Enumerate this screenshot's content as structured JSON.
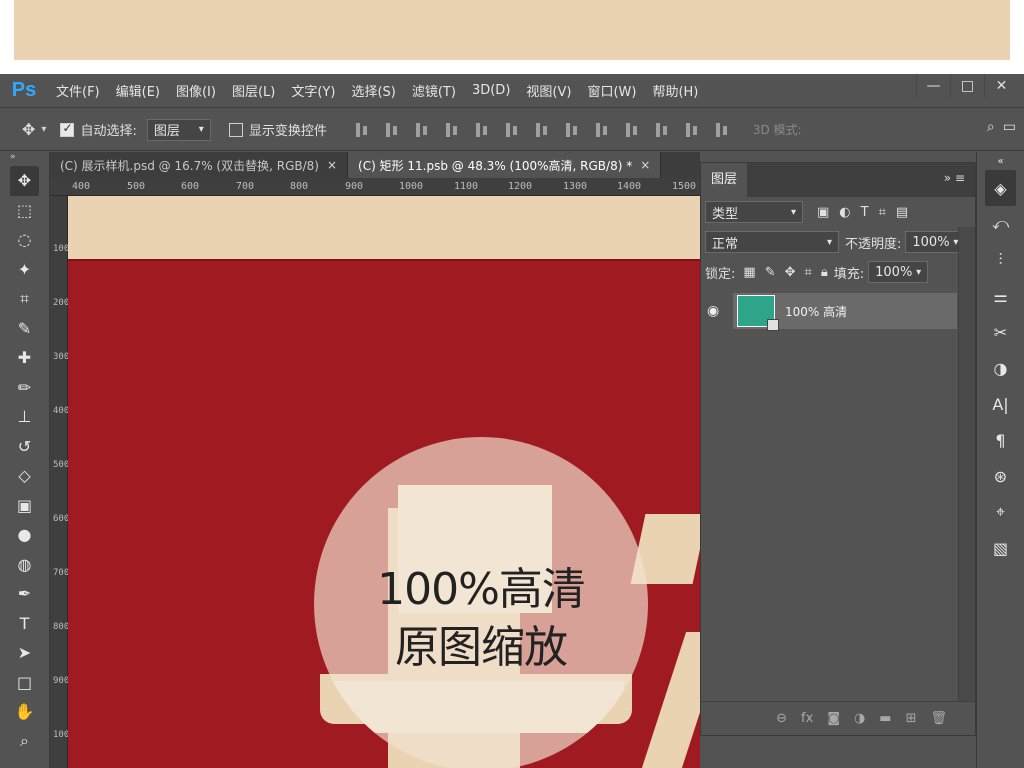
{
  "app": {
    "logo": "Ps",
    "menu": [
      "文件(F)",
      "编辑(E)",
      "图像(I)",
      "图层(L)",
      "文字(Y)",
      "选择(S)",
      "滤镜(T)",
      "3D(D)",
      "视图(V)",
      "窗口(W)",
      "帮助(H)"
    ],
    "window_controls": [
      "—",
      "□",
      "✕"
    ]
  },
  "options": {
    "move_icon": "move-tool-icon",
    "auto_select_label": "自动选择:",
    "auto_select_checked": true,
    "auto_select_target": "图层",
    "show_transform_label": "显示变换控件",
    "show_transform_checked": false,
    "mode_3d_label": "3D 模式:"
  },
  "tabs": [
    {
      "label": "(C) 展示样机.psd @ 16.7% (双击替换, RGB/8)",
      "close": "×",
      "active": false
    },
    {
      "label": "(C) 矩形 11.psb @ 48.3% (100%高清, RGB/8) *",
      "close": "×",
      "active": true
    }
  ],
  "ruler": {
    "top": [
      "400",
      "500",
      "600",
      "700",
      "800",
      "900",
      "1000",
      "1100",
      "1200",
      "1300",
      "1400",
      "1500"
    ],
    "left": [
      "100",
      "200",
      "300",
      "400",
      "500",
      "600",
      "700",
      "800",
      "900",
      "100"
    ]
  },
  "canvas": {
    "overlay_line1": "100%高清",
    "overlay_line2": "原图缩放",
    "colors": {
      "background": "#a01a21",
      "shape": "#e9d3b3",
      "circle": "#f2e2d2"
    }
  },
  "layers_panel": {
    "title": "图层",
    "filter_kind": "类型",
    "blend_mode": "正常",
    "opacity_label": "不透明度:",
    "opacity_value": "100%",
    "lock_label": "锁定:",
    "fill_label": "填充:",
    "fill_value": "100%",
    "layers": [
      {
        "name": "100% 高清",
        "visible": true,
        "thumb_color": "#2ea588"
      }
    ],
    "footer_icons": [
      "link-icon",
      "fx-icon",
      "mask-icon",
      "adjustment-icon",
      "folder-icon",
      "new-layer-icon",
      "trash-icon"
    ]
  },
  "toolbar": {
    "tools": [
      "move-tool-icon",
      "marquee-tool-icon",
      "lasso-tool-icon",
      "magic-wand-icon",
      "crop-tool-icon",
      "eyedropper-icon",
      "healing-brush-icon",
      "brush-tool-icon",
      "clone-stamp-icon",
      "history-brush-icon",
      "eraser-tool-icon",
      "gradient-tool-icon",
      "blur-tool-icon",
      "dodge-tool-icon",
      "pen-tool-icon",
      "type-tool-icon",
      "path-select-icon",
      "rectangle-tool-icon",
      "hand-tool-icon",
      "zoom-tool-icon"
    ]
  },
  "dock": {
    "items": [
      "layers-panel-icon",
      "history-icon",
      "properties-icon",
      "adjustments-icon",
      "tools-icon",
      "color-icon",
      "character-icon",
      "paragraph-icon",
      "channels-icon",
      "paths-icon",
      "glyphs-icon"
    ]
  }
}
